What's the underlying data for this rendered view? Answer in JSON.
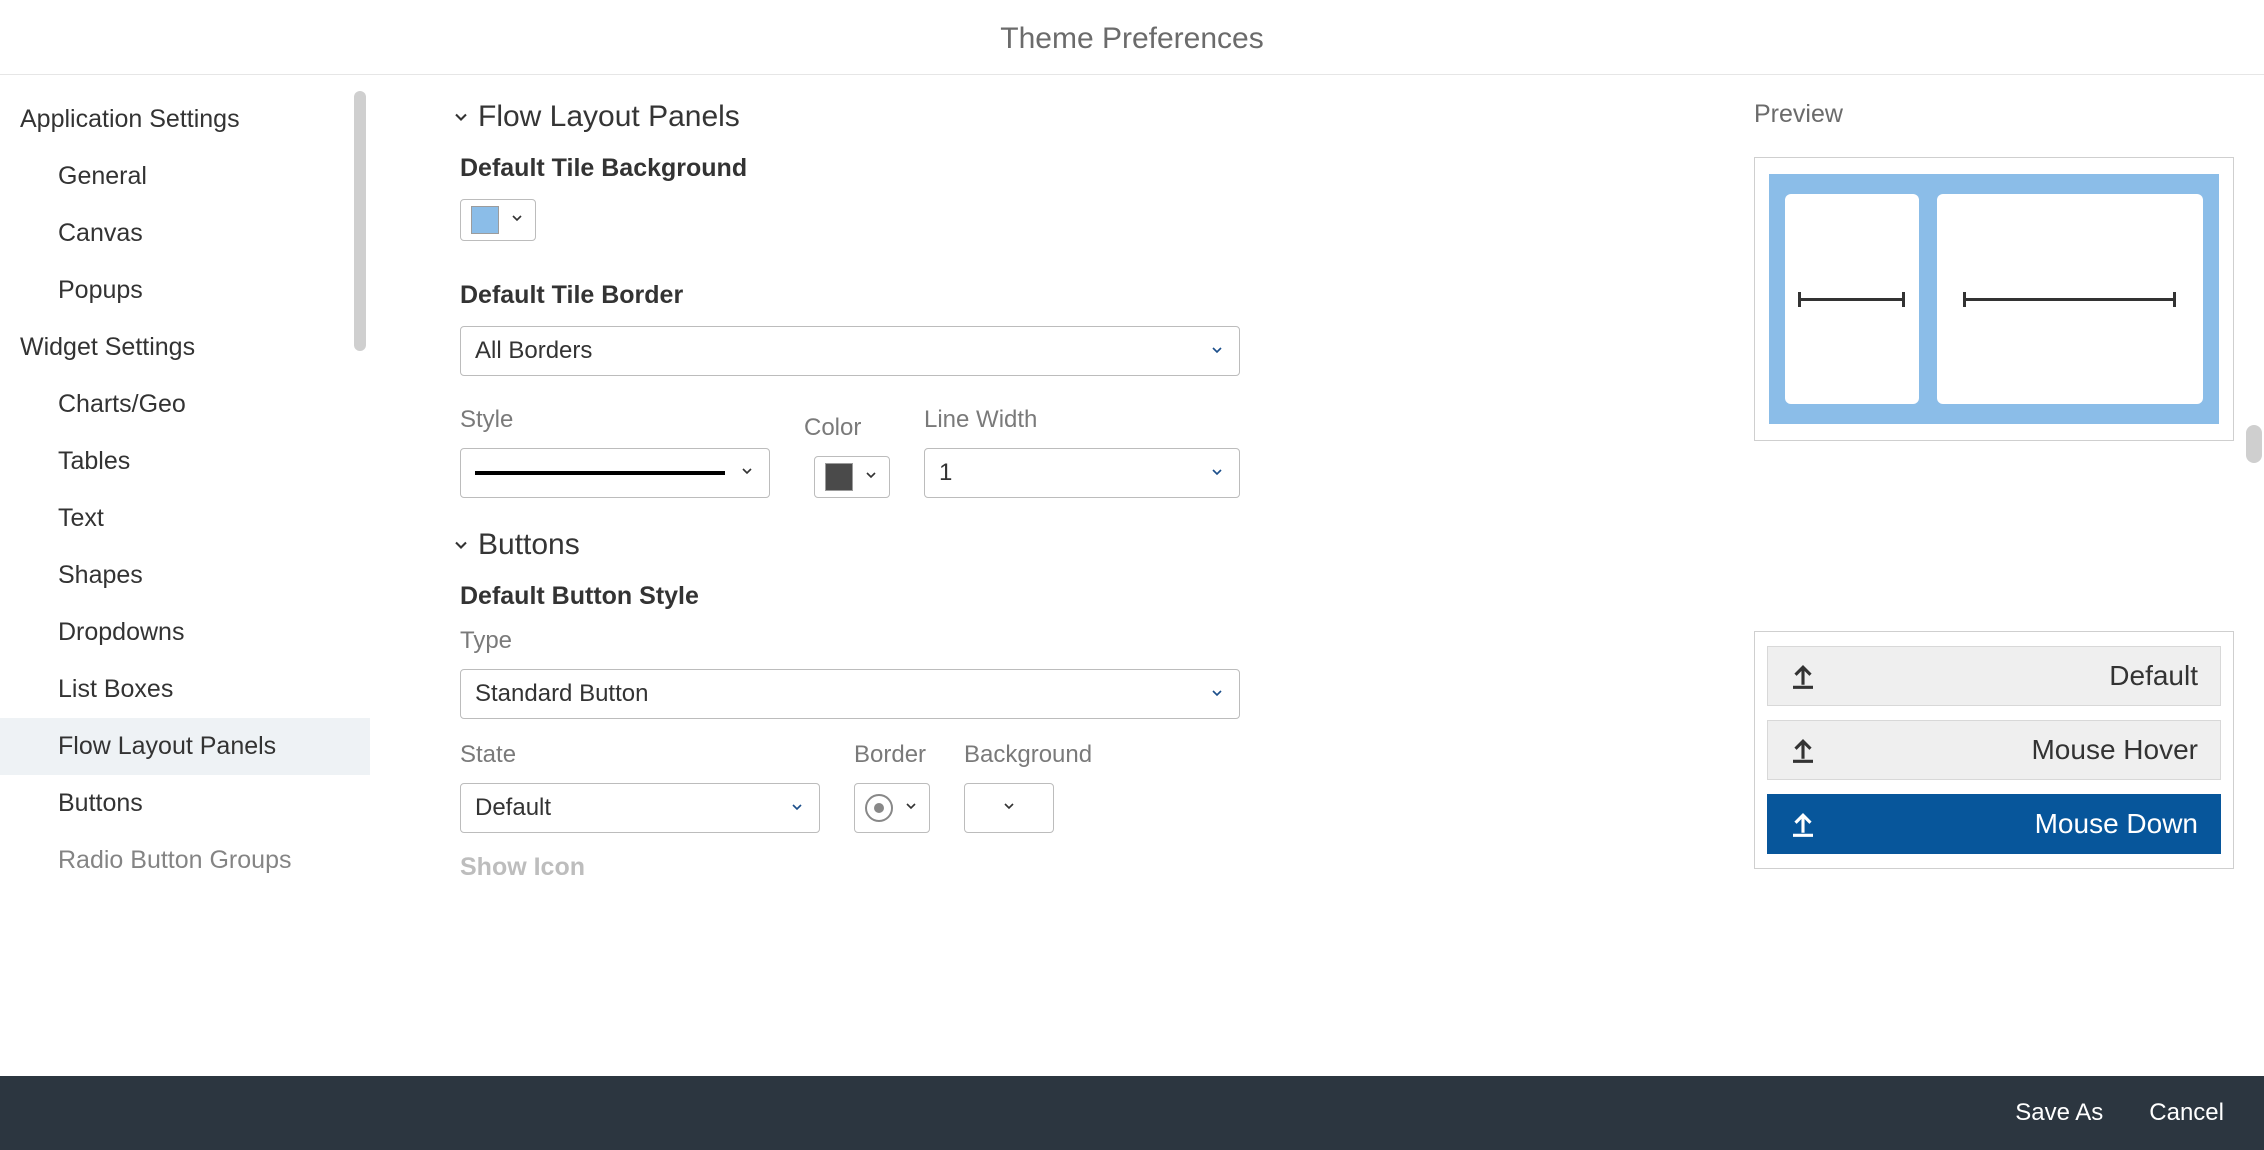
{
  "header": {
    "title": "Theme Preferences"
  },
  "sidebar": {
    "sections": [
      {
        "label": "Application Settings",
        "items": [
          {
            "label": "General"
          },
          {
            "label": "Canvas"
          },
          {
            "label": "Popups"
          }
        ]
      },
      {
        "label": "Widget Settings",
        "items": [
          {
            "label": "Charts/Geo"
          },
          {
            "label": "Tables"
          },
          {
            "label": "Text"
          },
          {
            "label": "Shapes"
          },
          {
            "label": "Dropdowns"
          },
          {
            "label": "List Boxes"
          },
          {
            "label": "Flow Layout Panels",
            "active": true
          },
          {
            "label": "Buttons"
          },
          {
            "label": "Radio Button Groups"
          }
        ]
      }
    ]
  },
  "flowLayout": {
    "heading": "Flow Layout Panels",
    "tileBackgroundLabel": "Default Tile Background",
    "tileBackgroundColor": "#8bbde8",
    "tileBorderLabel": "Default Tile Border",
    "tileBorderValue": "All Borders",
    "styleLabel": "Style",
    "colorLabel": "Color",
    "colorValue": "#4a4a4a",
    "lineWidthLabel": "Line Width",
    "lineWidthValue": "1"
  },
  "buttons": {
    "heading": "Buttons",
    "defaultStyleLabel": "Default Button Style",
    "typeLabel": "Type",
    "typeValue": "Standard Button",
    "stateLabel": "State",
    "stateValue": "Default",
    "borderLabel": "Border",
    "backgroundLabel": "Background",
    "showIconLabel": "Show Icon"
  },
  "preview": {
    "label": "Preview",
    "buttonStates": [
      {
        "label": "Default"
      },
      {
        "label": "Mouse Hover"
      },
      {
        "label": "Mouse Down",
        "active": true
      }
    ]
  },
  "footer": {
    "saveAs": "Save As",
    "cancel": "Cancel"
  }
}
